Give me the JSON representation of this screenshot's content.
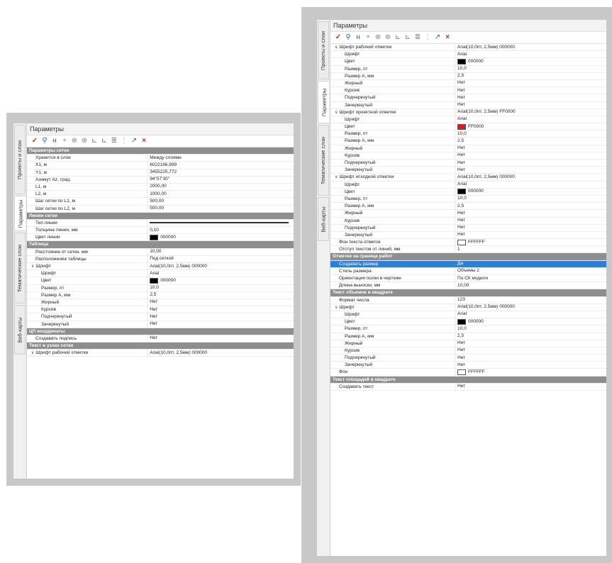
{
  "left": {
    "title": "Параметры",
    "tabs": [
      {
        "label": "Проекты и слои",
        "active": false
      },
      {
        "label": "Параметры",
        "active": true
      },
      {
        "label": "Тематические слои",
        "active": false
      },
      {
        "label": "Веб-карты",
        "active": false
      }
    ],
    "rows": [
      {
        "kind": "header",
        "label": "Параметры сетки"
      },
      {
        "kind": "prop",
        "level": 0,
        "label": "Хранится в слое",
        "value": "Между слоями"
      },
      {
        "kind": "prop",
        "level": 0,
        "label": "X1, м",
        "value": "6022186,999"
      },
      {
        "kind": "prop",
        "level": 0,
        "label": "Y1, м",
        "value": "3455225,772"
      },
      {
        "kind": "prop",
        "level": 0,
        "label": "Азимут Az, град.",
        "value": "  94°57'30\""
      },
      {
        "kind": "prop",
        "level": 0,
        "label": "L1, м",
        "value": "2000,00"
      },
      {
        "kind": "prop",
        "level": 0,
        "label": "L2, м",
        "value": "1000,00"
      },
      {
        "kind": "prop",
        "level": 0,
        "label": "Шаг сетки по L1, м",
        "value": "500,00"
      },
      {
        "kind": "prop",
        "level": 0,
        "label": "Шаг сетки по L2, м",
        "value": "500,00"
      },
      {
        "kind": "header",
        "label": "Линии сетки"
      },
      {
        "kind": "prop",
        "level": 0,
        "label": "Тип линии",
        "value": "",
        "line": true
      },
      {
        "kind": "prop",
        "level": 0,
        "label": "Толщина линии, мм",
        "value": "0,10"
      },
      {
        "kind": "prop",
        "level": 0,
        "label": "Цвет линии",
        "value": "000000",
        "swatch": "#000000"
      },
      {
        "kind": "header",
        "label": "Таблица"
      },
      {
        "kind": "prop",
        "level": 0,
        "label": "Расстояние от сетки, мм",
        "value": "10,00"
      },
      {
        "kind": "prop",
        "level": 0,
        "label": "Расположение таблицы",
        "value": "Под сеткой"
      },
      {
        "kind": "prop",
        "level": 0,
        "label": "Шрифт",
        "value": "Arial(10,0пт, 2,5мм) 000000",
        "expand": true
      },
      {
        "kind": "prop",
        "level": 1,
        "label": "Шрифт",
        "value": "Arial"
      },
      {
        "kind": "prop",
        "level": 1,
        "label": "Цвет",
        "value": "000000",
        "swatch": "#000000"
      },
      {
        "kind": "prop",
        "level": 1,
        "label": "Размер, пт",
        "value": "10,0"
      },
      {
        "kind": "prop",
        "level": 1,
        "label": "Размер А, мм",
        "value": "2,5"
      },
      {
        "kind": "prop",
        "level": 1,
        "label": "Жирный",
        "value": "Нет"
      },
      {
        "kind": "prop",
        "level": 1,
        "label": "Курсив",
        "value": "Нет"
      },
      {
        "kind": "prop",
        "level": 1,
        "label": "Подчеркнутый",
        "value": "Нет"
      },
      {
        "kind": "prop",
        "level": 1,
        "label": "Зачеркнутый",
        "value": "Нет"
      },
      {
        "kind": "header",
        "label": "ЦП координаты"
      },
      {
        "kind": "prop",
        "level": 0,
        "label": "Создавать подпись",
        "value": "Нет"
      },
      {
        "kind": "header",
        "label": "Текст в узлах сетки"
      },
      {
        "kind": "prop",
        "level": 0,
        "label": "Шрифт рабочей отметки",
        "value": "Arial(10,0пт, 2,5мм) 000000",
        "expand": true
      }
    ]
  },
  "right": {
    "title": "Параметры",
    "tabs": [
      {
        "label": "Проекты и слои",
        "active": false
      },
      {
        "label": "Параметры",
        "active": true
      },
      {
        "label": "Тематические слои",
        "active": false
      },
      {
        "label": "Веб-карты",
        "active": false
      }
    ],
    "rows": [
      {
        "kind": "prop",
        "level": 0,
        "label": "Шрифт рабочей отметки",
        "value": "Arial(10,0пт, 2,5мм) 000000",
        "expand": true
      },
      {
        "kind": "prop",
        "level": 1,
        "label": "Шрифт",
        "value": "Arial"
      },
      {
        "kind": "prop",
        "level": 1,
        "label": "Цвет",
        "value": "000000",
        "swatch": "#000000"
      },
      {
        "kind": "prop",
        "level": 1,
        "label": "Размер, пт",
        "value": "10,0"
      },
      {
        "kind": "prop",
        "level": 1,
        "label": "Размер А, мм",
        "value": "2,5"
      },
      {
        "kind": "prop",
        "level": 1,
        "label": "Жирный",
        "value": "Нет"
      },
      {
        "kind": "prop",
        "level": 1,
        "label": "Курсив",
        "value": "Нет"
      },
      {
        "kind": "prop",
        "level": 1,
        "label": "Подчеркнутый",
        "value": "Нет"
      },
      {
        "kind": "prop",
        "level": 1,
        "label": "Зачеркнутый",
        "value": "Нет"
      },
      {
        "kind": "prop",
        "level": 0,
        "label": "Шрифт проектной отметки",
        "value": "Arial(10,0пт, 2,5мм) FF0000",
        "expand": true
      },
      {
        "kind": "prop",
        "level": 1,
        "label": "Шрифт",
        "value": "Arial"
      },
      {
        "kind": "prop",
        "level": 1,
        "label": "Цвет",
        "value": "FF0000",
        "swatch": "#e01b1b"
      },
      {
        "kind": "prop",
        "level": 1,
        "label": "Размер, пт",
        "value": "10,0"
      },
      {
        "kind": "prop",
        "level": 1,
        "label": "Размер А, мм",
        "value": "2,5"
      },
      {
        "kind": "prop",
        "level": 1,
        "label": "Жирный",
        "value": "Нет"
      },
      {
        "kind": "prop",
        "level": 1,
        "label": "Курсив",
        "value": "Нет"
      },
      {
        "kind": "prop",
        "level": 1,
        "label": "Подчеркнутый",
        "value": "Нет"
      },
      {
        "kind": "prop",
        "level": 1,
        "label": "Зачеркнутый",
        "value": "Нет"
      },
      {
        "kind": "prop",
        "level": 0,
        "label": "Шрифт исходной отметки",
        "value": "Arial(10,0пт, 2,5мм) 000000",
        "expand": true
      },
      {
        "kind": "prop",
        "level": 1,
        "label": "Шрифт",
        "value": "Arial"
      },
      {
        "kind": "prop",
        "level": 1,
        "label": "Цвет",
        "value": "000000",
        "swatch": "#000000"
      },
      {
        "kind": "prop",
        "level": 1,
        "label": "Размер, пт",
        "value": "10,0"
      },
      {
        "kind": "prop",
        "level": 1,
        "label": "Размер А, мм",
        "value": "2,5"
      },
      {
        "kind": "prop",
        "level": 1,
        "label": "Жирный",
        "value": "Нет"
      },
      {
        "kind": "prop",
        "level": 1,
        "label": "Курсив",
        "value": "Нет"
      },
      {
        "kind": "prop",
        "level": 1,
        "label": "Подчеркнутый",
        "value": "Нет"
      },
      {
        "kind": "prop",
        "level": 1,
        "label": "Зачеркнутый",
        "value": "Нет"
      },
      {
        "kind": "prop",
        "level": 0,
        "label": "Фон текста отметок",
        "value": "FFFFFF",
        "swatch": "#ffffff"
      },
      {
        "kind": "prop",
        "level": 0,
        "label": "Отступ текстов от линий, мм",
        "value": "1"
      },
      {
        "kind": "header",
        "label": "Отметки на границе работ"
      },
      {
        "kind": "prop",
        "level": 0,
        "label": "Создавать размер",
        "value": "Да",
        "selected": true
      },
      {
        "kind": "prop",
        "level": 0,
        "label": "Стиль размера",
        "value": "Объемы 2"
      },
      {
        "kind": "prop",
        "level": 0,
        "label": "Ориентация полки в чертеже",
        "value": "По СК модели"
      },
      {
        "kind": "prop",
        "level": 0,
        "label": "Длина выноски, мм",
        "value": "10,00"
      },
      {
        "kind": "header",
        "label": "Текст объемов в квадрате"
      },
      {
        "kind": "prop",
        "level": 0,
        "label": "Формат числа",
        "value": "123"
      },
      {
        "kind": "prop",
        "level": 0,
        "label": "Шрифт",
        "value": "Arial(10,0пт, 2,5мм) 000000",
        "expand": true
      },
      {
        "kind": "prop",
        "level": 1,
        "label": "Шрифт",
        "value": "Arial"
      },
      {
        "kind": "prop",
        "level": 1,
        "label": "Цвет",
        "value": "000000",
        "swatch": "#000000"
      },
      {
        "kind": "prop",
        "level": 1,
        "label": "Размер, пт",
        "value": "10,0"
      },
      {
        "kind": "prop",
        "level": 1,
        "label": "Размер А, мм",
        "value": "2,5"
      },
      {
        "kind": "prop",
        "level": 1,
        "label": "Жирный",
        "value": "Нет"
      },
      {
        "kind": "prop",
        "level": 1,
        "label": "Курсив",
        "value": "Нет"
      },
      {
        "kind": "prop",
        "level": 1,
        "label": "Подчеркнутый",
        "value": "Нет"
      },
      {
        "kind": "prop",
        "level": 1,
        "label": "Зачеркнутый",
        "value": "Нет"
      },
      {
        "kind": "prop",
        "level": 0,
        "label": "Фон",
        "value": "FFFFFF",
        "swatch": "#ffffff"
      },
      {
        "kind": "header",
        "label": "Текст площадей в квадрате"
      },
      {
        "kind": "prop",
        "level": 0,
        "label": "Создавать текст",
        "value": "Нет"
      }
    ]
  },
  "toolbar": [
    {
      "icon": "check-icon",
      "glyph": "✓",
      "style": "red"
    },
    {
      "icon": "filter-icon",
      "glyph": "⚲",
      "style": "blue"
    },
    {
      "icon": "mark-icon",
      "glyph": "н",
      "style": "blue"
    },
    {
      "icon": "add-point-icon",
      "glyph": "+",
      "style": "grey"
    },
    {
      "icon": "crosshair-icon",
      "glyph": "⊕",
      "style": "grey"
    },
    {
      "icon": "crosshair-alt-icon",
      "glyph": "⊕",
      "style": "grey"
    },
    {
      "icon": "layer-down-icon",
      "glyph": "⊾",
      "style": "grey"
    },
    {
      "icon": "layer-up-icon",
      "glyph": "⊾",
      "style": "grey"
    },
    {
      "icon": "align-icon",
      "glyph": "≣",
      "style": "grey"
    },
    {
      "icon": "grid-icon",
      "glyph": "⋮",
      "style": "grey"
    },
    {
      "icon": "pick-icon",
      "glyph": "↗",
      "style": "blue"
    },
    {
      "icon": "close-icon",
      "glyph": "×",
      "style": "red"
    }
  ]
}
